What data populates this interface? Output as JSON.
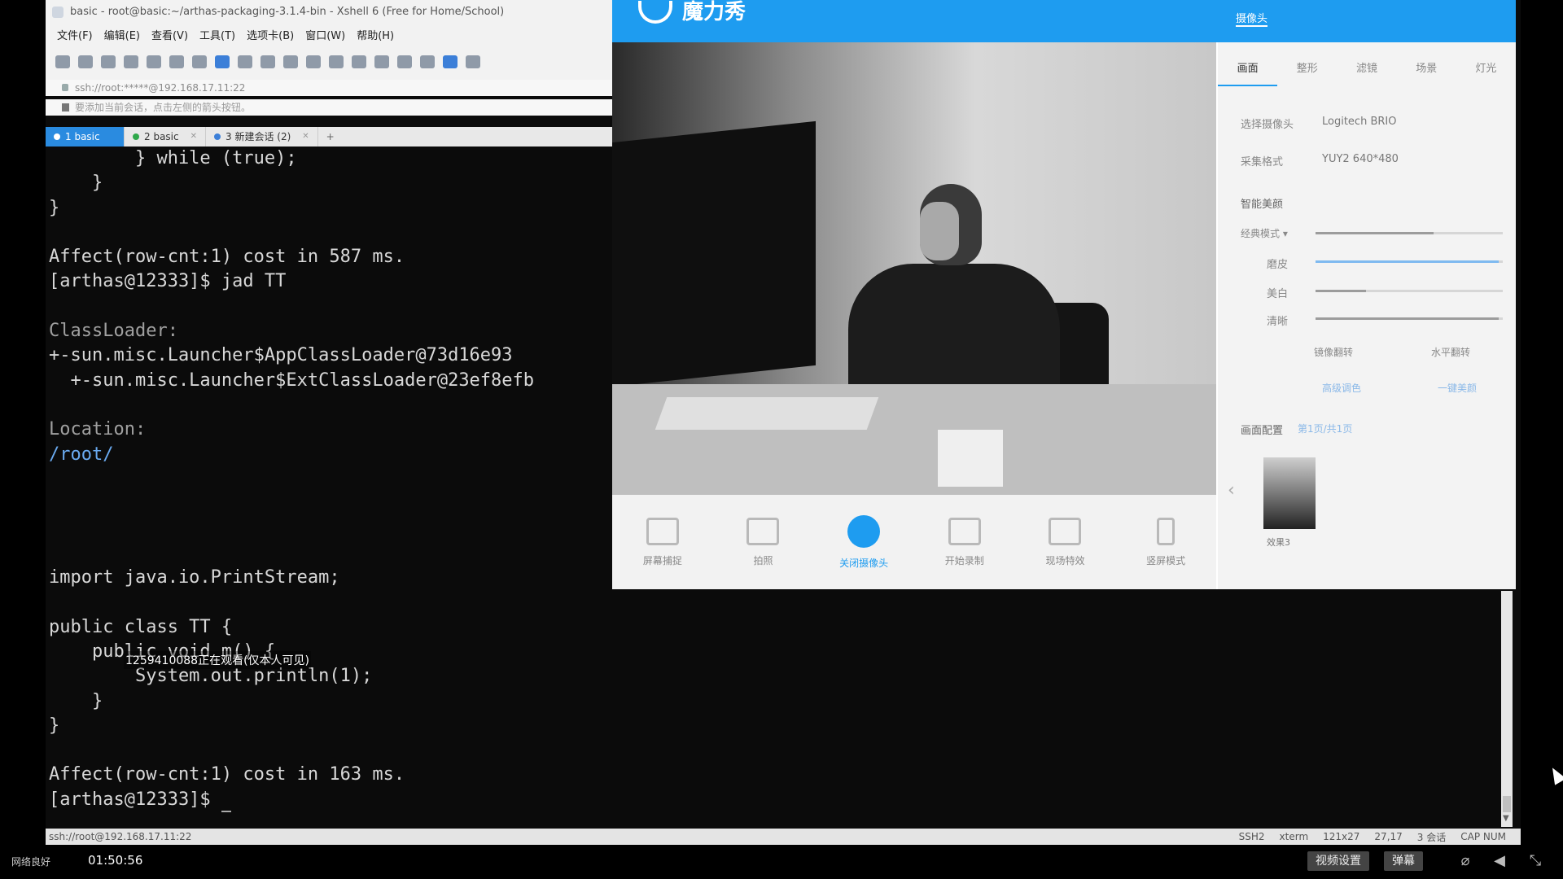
{
  "xshell": {
    "title": "basic - root@basic:~/arthas-packaging-3.1.4-bin - Xshell 6 (Free for Home/School)",
    "menu": [
      "文件(F)",
      "编辑(E)",
      "查看(V)",
      "工具(T)",
      "选项卡(B)",
      "窗口(W)",
      "帮助(H)"
    ],
    "address": "ssh://root:*****@192.168.17.11:22",
    "hint": "要添加当前会话，点击左侧的箭头按钮。",
    "tabs": [
      {
        "label": "1 basic",
        "active": true
      },
      {
        "label": "2 basic",
        "active": false
      },
      {
        "label": "3 新建会话 (2)",
        "active": false
      }
    ],
    "terminal": {
      "l1": "        } while (true);",
      "l2": "    }",
      "l3": "}",
      "l4": "",
      "l5": "Affect(row-cnt:1) cost in 587 ms.",
      "l6": "[arthas@12333]$ jad TT",
      "l7": "",
      "l8": "ClassLoader:",
      "l9": "+-sun.misc.Launcher$AppClassLoader@73d16e93",
      "l10": "  +-sun.misc.Launcher$ExtClassLoader@23ef8efb",
      "l11": "",
      "l12": "Location:",
      "l13": "/root/",
      "l18": "import java.io.PrintStream;",
      "l20": "public class TT {",
      "l21": "    public void m() {",
      "l22": "        System.out.println(1);",
      "l23": "    }",
      "l24": "}",
      "l26": "Affect(row-cnt:1) cost in 163 ms.",
      "l27": "[arthas@12333]$ "
    },
    "overlay": "1259410088正在观看(仅本人可见)",
    "status": {
      "left": "ssh://root@192.168.17.11:22",
      "items": [
        "SSH2",
        "xterm",
        "121x27",
        "27,17",
        "3 会话",
        "CAP NUM"
      ]
    }
  },
  "camapp": {
    "logo": "魔力秀",
    "header_tabs": [
      "摄像头",
      "",
      ""
    ],
    "panel_tabs": [
      "画面",
      "整形",
      "滤镜",
      "场景",
      "灯光"
    ],
    "select_camera_label": "选择摄像头",
    "select_camera_value": "Logitech BRIO",
    "capture_format_label": "采集格式",
    "capture_format_value": "YUY2 640*480",
    "beauty_title": "智能美颜",
    "beauty_mode": "经典模式 ▾",
    "sliders": {
      "skin_label": "磨皮",
      "whiten_label": "美白",
      "sharpen_label": "清晰"
    },
    "levels": {
      "classic": 0.63,
      "skin": 0.98,
      "whiten": 0.27,
      "sharpen": 0.98
    },
    "mirror": "镜像翻转",
    "flip": "水平翻转",
    "adv_color": "高级调色",
    "one_key": "一键美颜",
    "preset_title": "画面配置",
    "preset_page": "第1页/共1页",
    "thumb_label": "效果3",
    "tools": [
      "屏幕捕捉",
      "拍照",
      "关闭摄像头",
      "开始录制",
      "现场特效",
      "竖屏模式"
    ]
  },
  "player": {
    "network": "网络良好",
    "time": "01:50:56",
    "btn_video": "视频设置",
    "btn_dm": "弹幕",
    "colors": {
      "accent": "#1e9cf0"
    }
  }
}
